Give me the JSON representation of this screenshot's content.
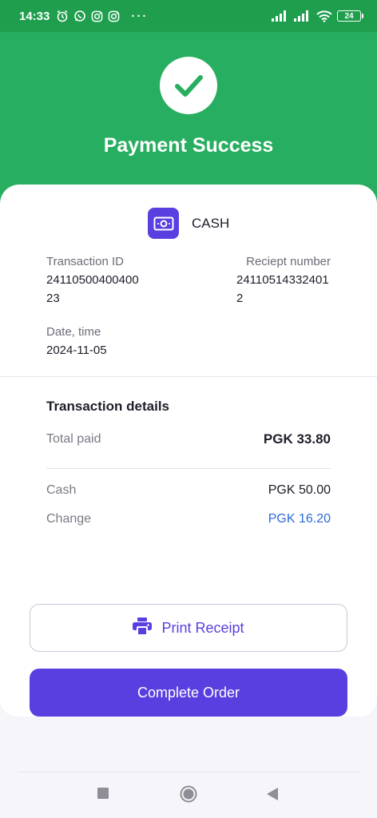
{
  "status_bar": {
    "time": "14:33",
    "icons": [
      "alarm-icon",
      "whatsapp-icon",
      "instagram-icon",
      "instagram-icon"
    ],
    "more": "···",
    "battery": "24"
  },
  "header": {
    "title": "Payment Success",
    "background_color": "#27AE60"
  },
  "payment_method": {
    "icon": "cash-icon",
    "label": "CASH"
  },
  "transaction_info": {
    "transaction_id_label": "Transaction ID",
    "transaction_id_value": "2411050040040023",
    "receipt_number_label": "Reciept number",
    "receipt_number_value": "241105143324012",
    "date_label": "Date, time",
    "date_value": "2024-11-05"
  },
  "transaction_details": {
    "title": "Transaction details",
    "total_paid_label": "Total paid",
    "total_paid_value": "PGK 33.80",
    "cash_label": "Cash",
    "cash_value": "PGK 50.00",
    "change_label": "Change",
    "change_value": "PGK 16.20"
  },
  "actions": {
    "print_label": "Print Receipt",
    "complete_label": "Complete Order",
    "accent_color": "#5A3FE0"
  }
}
